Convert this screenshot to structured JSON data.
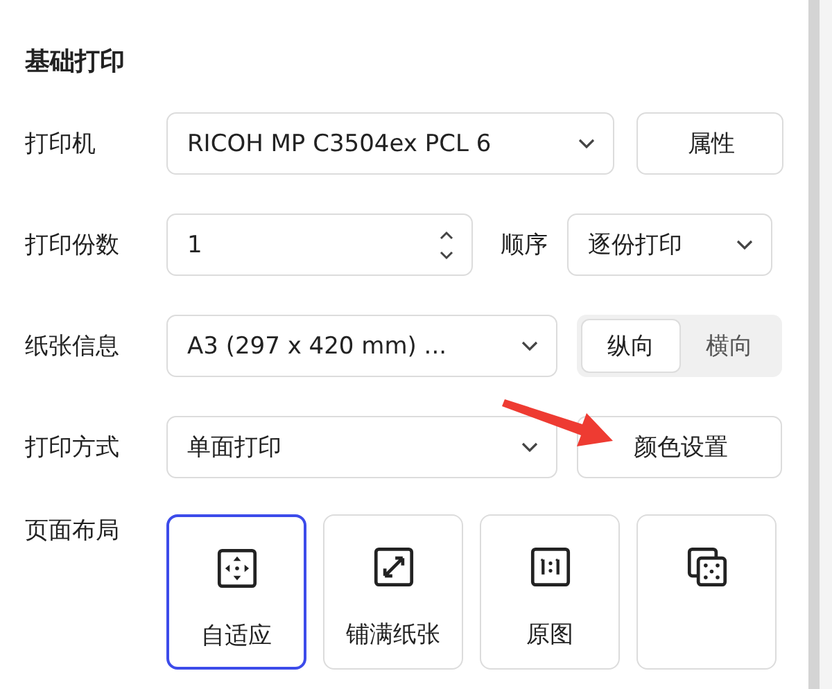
{
  "section_title": "基础打印",
  "rows": [
    {
      "label": "打印机",
      "kind": "select-button",
      "value": "RICOH MP C3504ex PCL 6",
      "button": "属性"
    },
    {
      "label": "打印份数",
      "kind": "number-select",
      "value": "1",
      "sub_label": "顺序",
      "select": "逐份打印"
    },
    {
      "label": "纸张信息",
      "kind": "select-toggle",
      "value": "A3 (297 x 420 mm) ...",
      "options": [
        {
          "label": "纵向",
          "selected": true
        },
        {
          "label": "横向",
          "selected": false
        }
      ]
    },
    {
      "label": "打印方式",
      "kind": "select-button",
      "value": "单面打印",
      "button": "颜色设置"
    }
  ],
  "layout": {
    "label": "页面布局",
    "cards": [
      {
        "kind": "fit",
        "label": "自适应",
        "selected": true
      },
      {
        "kind": "fill",
        "label": "铺满纸张",
        "selected": false
      },
      {
        "kind": "original",
        "label": "原图",
        "selected": false
      },
      {
        "kind": "multi",
        "selected": false
      }
    ]
  },
  "annotation_arrow": true
}
